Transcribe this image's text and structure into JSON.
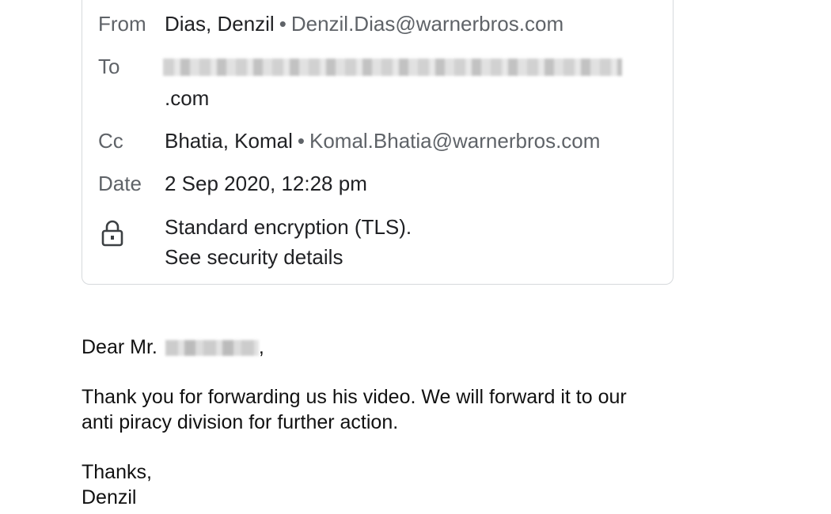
{
  "header": {
    "from_label": "From",
    "from_name": "Dias, Denzil",
    "from_email": "Denzil.Dias@warnerbros.com",
    "to_label": "To",
    "to_domain": ".com",
    "cc_label": "Cc",
    "cc_name": "Bhatia, Komal",
    "cc_email": "Komal.Bhatia@warnerbros.com",
    "date_label": "Date",
    "date_value": "2 Sep 2020, 12:28 pm",
    "encryption_text": "Standard encryption (TLS).",
    "security_link": "See security details",
    "separator": "•",
    "lock_icon": "lock-icon"
  },
  "body": {
    "greeting": "Dear Mr.",
    "greeting_punct": ",",
    "line1": "Thank you for forwarding us his video. We will forward it to our",
    "line2": "anti piracy division for further action.",
    "signoff": "Thanks,",
    "signature": "Denzil"
  },
  "colors": {
    "link": "#1a73e8",
    "label": "#5f6368",
    "text": "#202124",
    "border": "#d6d9dc"
  }
}
